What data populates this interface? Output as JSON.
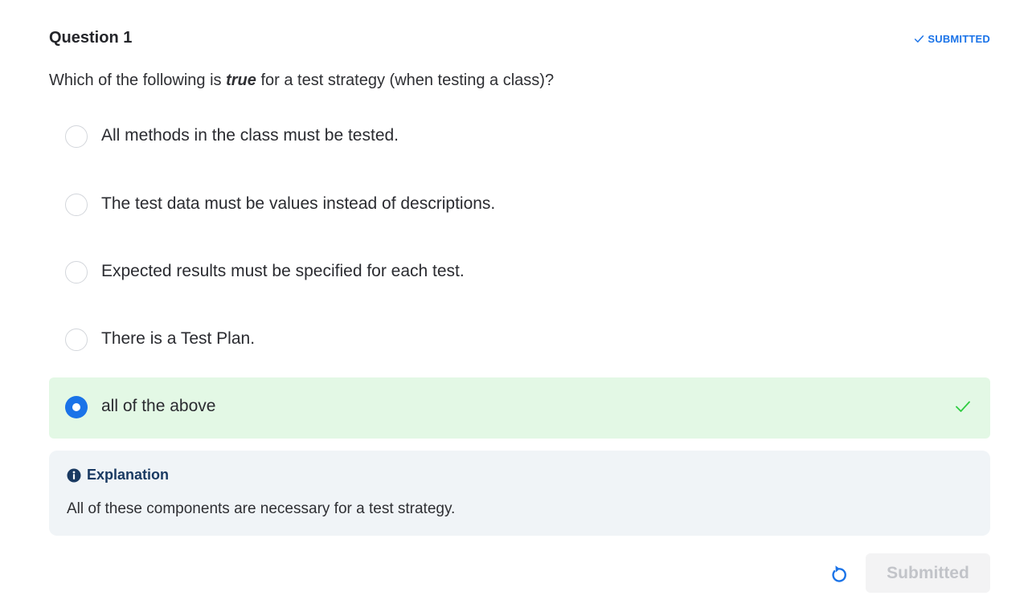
{
  "question": {
    "title": "Question 1",
    "status": "SUBMITTED",
    "status_icon": "check-icon",
    "prompt_before": "Which of the following is ",
    "prompt_emphasis": "true",
    "prompt_after": " for a test strategy (when testing a class)?"
  },
  "options": [
    {
      "label": "All methods in the class must be tested.",
      "selected": false
    },
    {
      "label": "The test data must be values instead of descriptions.",
      "selected": false
    },
    {
      "label": "Expected results must be specified for each test.",
      "selected": false
    },
    {
      "label": "There is a Test Plan.",
      "selected": false
    },
    {
      "label": "all of the above",
      "selected": true,
      "correct": true
    }
  ],
  "explanation": {
    "icon": "info-icon",
    "title": "Explanation",
    "text": "All of these components are necessary for a test strategy."
  },
  "actions": {
    "reset_icon": "reset-icon",
    "submit_label": "Submitted"
  },
  "colors": {
    "accent": "#1a73e8",
    "correct_bg": "#e3f8e5",
    "correct_check": "#2ecc40",
    "explanation_bg": "#f0f4f7",
    "explanation_title": "#1a3a62"
  }
}
